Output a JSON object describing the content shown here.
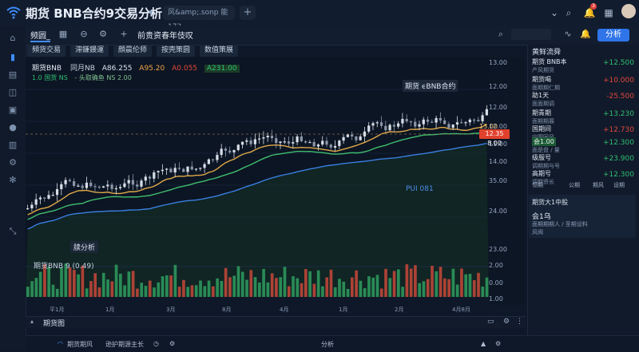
{
  "window": {
    "title": "期货 BNB合约9交易分析",
    "search_tab": "风&amp;.sonp 能 173",
    "analysis_button": "分析"
  },
  "toolbar": {
    "tab_label": "频圆_",
    "main_title": "前贵资春年伎叹"
  },
  "subbar": [
    "頻货交易",
    "滞鎌鏝運",
    "顔晨伦师",
    "按壳策圆",
    "数值策展"
  ],
  "legend": {
    "symbol": "期货BNB",
    "items": [
      {
        "text": "同月NB",
        "color": "#c7d2e2"
      },
      {
        "text": "A86.255",
        "color": "#d9e3f0"
      },
      {
        "text": "A95.20",
        "color": "#f0a24a"
      },
      {
        "text": "A0.055",
        "color": "#e2473c"
      },
      {
        "text": "A231.00",
        "color": "#2fbf71"
      }
    ],
    "row2": [
      "1.0 国货 NS",
      "- 头取确鱼 NS 2.00"
    ]
  },
  "annotations": {
    "top": "期货 ϵBNB合约",
    "line": "PUI 081",
    "bottom": "牍分析"
  },
  "price_axis": [
    "13.00",
    "12.00",
    "12.00",
    "12.00",
    "11.00",
    "14.00",
    "35.00",
    "24.00",
    "23.00",
    "2.00",
    "0.00",
    "1.00"
  ],
  "price_tag": "12.35 8.00",
  "price_tag_top": "13.00",
  "volume_title": "期货BNB 9 (0.49)",
  "time_axis": [
    "平1月",
    "1月",
    "3月",
    "8月",
    "4月",
    "1月",
    "2月",
    "4月8月"
  ],
  "bottom_panel": {
    "title": "期货图"
  },
  "statusbar": [
    "期货期风",
    "逊护期源主长",
    "分析"
  ],
  "right_panel": {
    "title": "黄鲜流舜",
    "rows": [
      {
        "name": "期货 BNB本",
        "sub": "产风期货",
        "value": "+12.500",
        "dir": "up"
      },
      {
        "name": "期货喝",
        "sub": "面期期仁期",
        "value": "+10.000",
        "dir": "down"
      },
      {
        "name": "助1天",
        "sub": "面面期调",
        "value": "-25.500",
        "dir": "down"
      },
      {
        "name": "期青期",
        "sub": "面期期展",
        "value": "+13.230",
        "dir": "up"
      },
      {
        "name": "国期间",
        "sub": "宁圆同风",
        "value": "+12.730",
        "dir": "down"
      },
      {
        "name": "会1.00",
        "sub": "面是盘 / 量",
        "value": "+12.300",
        "dir": "up"
      },
      {
        "name": "级服号",
        "sub": "调期期与号",
        "value": "+23.900",
        "dir": "up"
      },
      {
        "name": "高期号",
        "sub": "调期资长",
        "value": "+12.300",
        "dir": "up"
      }
    ],
    "tabs": [
      "领期",
      "公期",
      "期风",
      "设期"
    ],
    "card": {
      "title": "期货大1中股",
      "line1": "会1乌",
      "line2": "面期期期人 / 圣期设料",
      "line3": "风阀"
    }
  },
  "chart_data": {
    "type": "candlestick",
    "title": "期货BNB",
    "series": [
      {
        "name": "MA(short)",
        "color": "#e0a94a"
      },
      {
        "name": "MA(mid)",
        "color": "#3fbf6f"
      },
      {
        "name": "MA(long)",
        "color": "#3a7fe0"
      }
    ],
    "trend": "upward",
    "volume": true
  },
  "colors": {
    "accent": "#3f8cff",
    "up": "#2fbf71",
    "down": "#e2473c"
  }
}
